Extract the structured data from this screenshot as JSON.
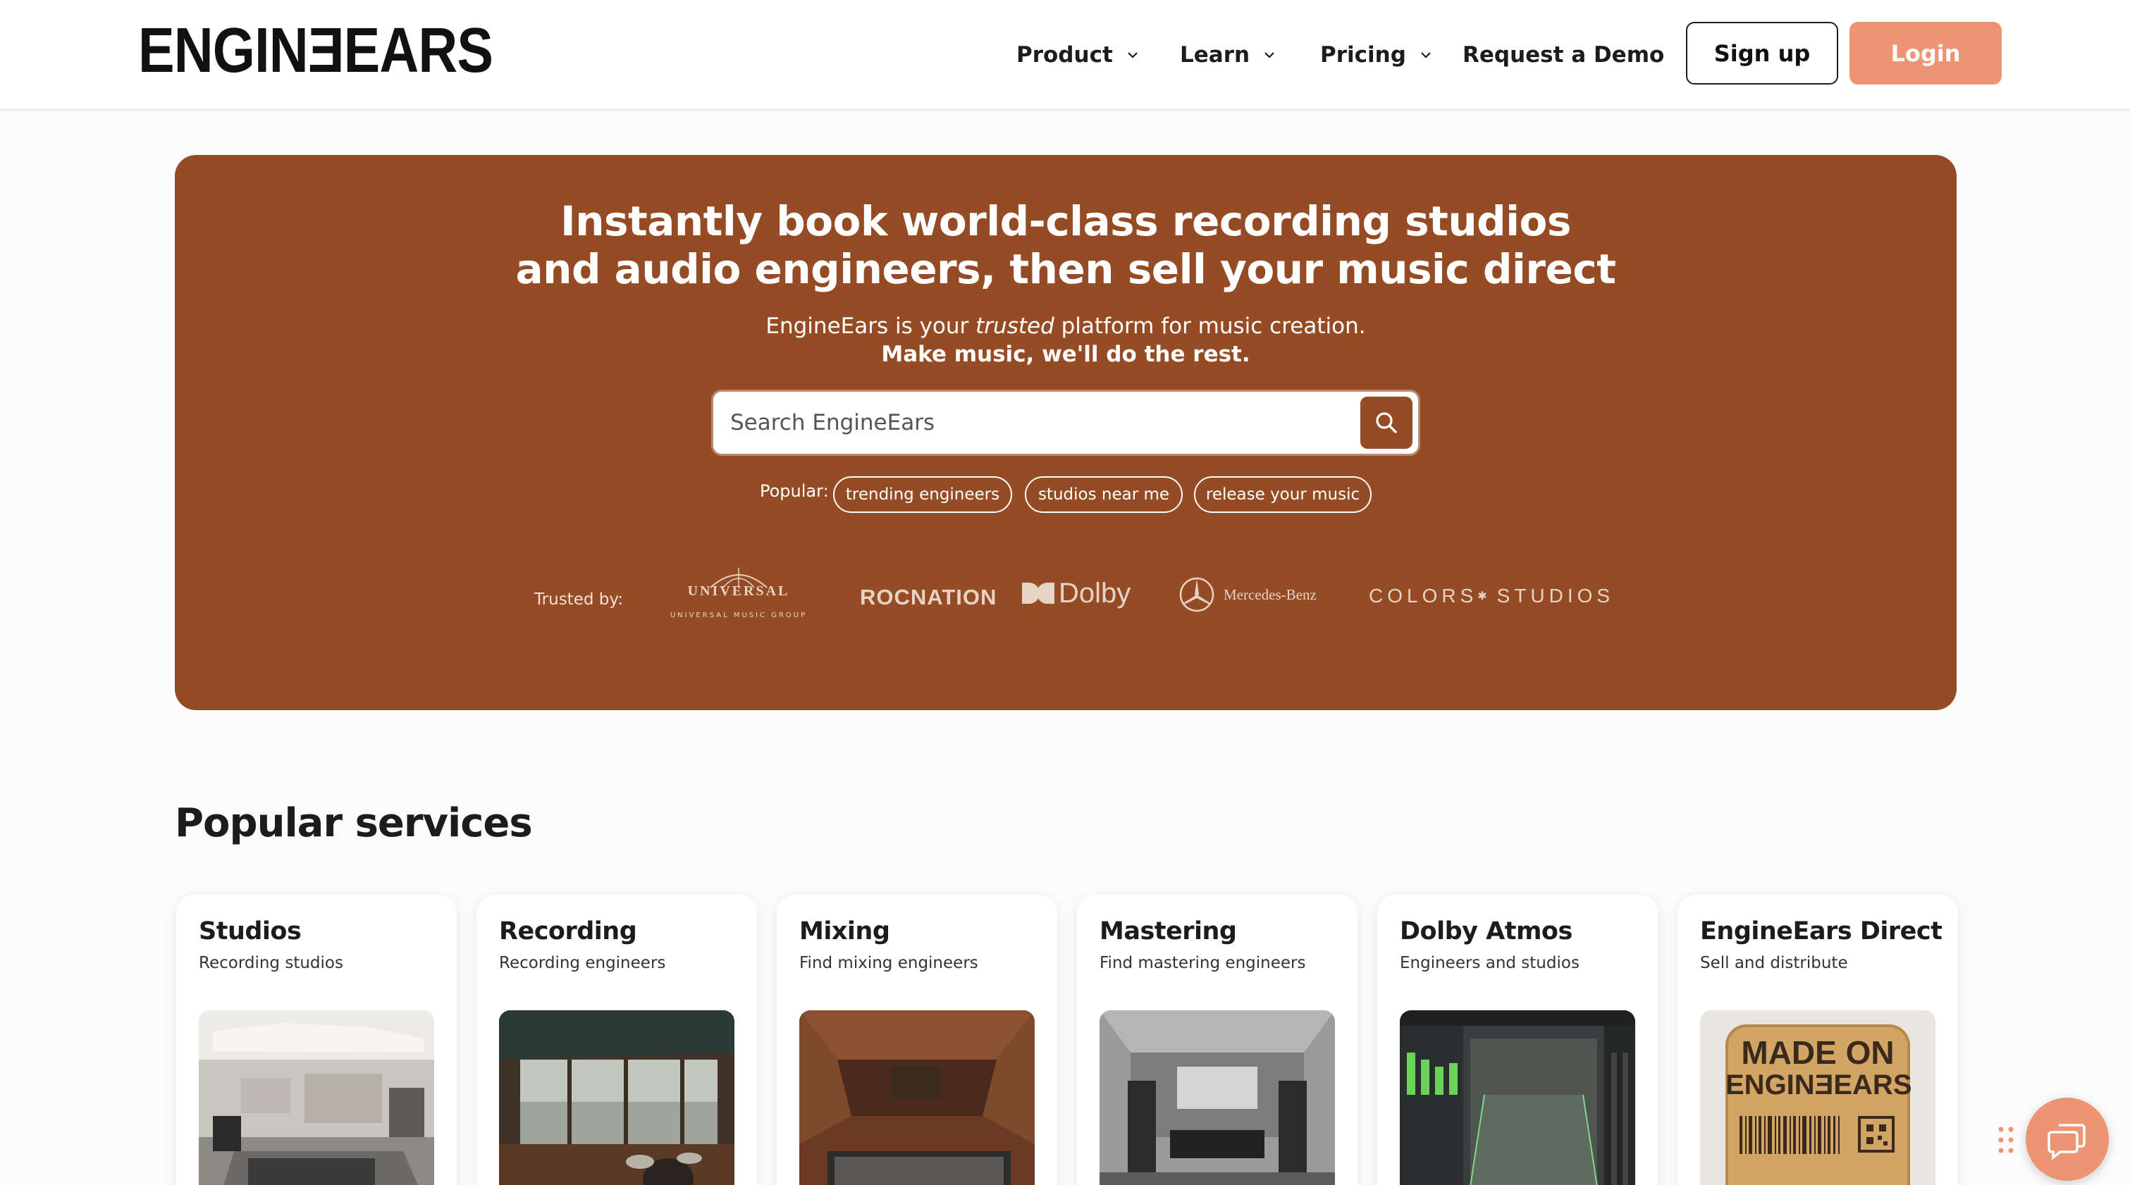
{
  "header": {
    "logo": "ENGINƎEARS",
    "nav": [
      {
        "label": "Product",
        "has_dropdown": true
      },
      {
        "label": "Learn",
        "has_dropdown": true
      },
      {
        "label": "Pricing",
        "has_dropdown": true
      },
      {
        "label": "Request a Demo",
        "has_dropdown": false
      }
    ],
    "signup_label": "Sign up",
    "login_label": "Login"
  },
  "hero": {
    "title_line1": "Instantly book world-class recording studios",
    "title_line2": "and audio engineers, then sell your music direct",
    "subtitle_before": "EngineEars is your",
    "subtitle_em": "trusted",
    "subtitle_after": "platform for music creation.",
    "subtitle_bold": "Make music, we'll do the rest.",
    "search_placeholder": "Search EngineEars",
    "popular_label": "Popular:",
    "popular_chips": [
      "trending engineers",
      "studios near me",
      "release your music"
    ],
    "trusted_label": "Trusted by:",
    "brands": {
      "universal": "UNIVERSAL",
      "universal_sub": "UNIVERSAL MUSIC GROUP",
      "rocnation": "ROCNATION",
      "dolby": "Dolby",
      "mercedes": "Mercedes-Benz",
      "colors": "COLORS",
      "colors_suffix": "STUDIOS"
    }
  },
  "popular_services": {
    "title": "Popular services",
    "cards": [
      {
        "title": "Studios",
        "subtitle": "Recording studios"
      },
      {
        "title": "Recording",
        "subtitle": "Recording engineers"
      },
      {
        "title": "Mixing",
        "subtitle": "Find mixing engineers"
      },
      {
        "title": "Mastering",
        "subtitle": "Find mastering engineers"
      },
      {
        "title": "Dolby Atmos",
        "subtitle": "Engineers and studios"
      },
      {
        "title": "EngineEars Direct",
        "subtitle": "Sell and distribute"
      }
    ],
    "badge_line1": "MADE ON",
    "badge_line2": "ENGINƎEARS"
  },
  "colors": {
    "hero_bg": "#954b23",
    "accent": "#ee9475",
    "page_bg": "#fbfbfb"
  }
}
